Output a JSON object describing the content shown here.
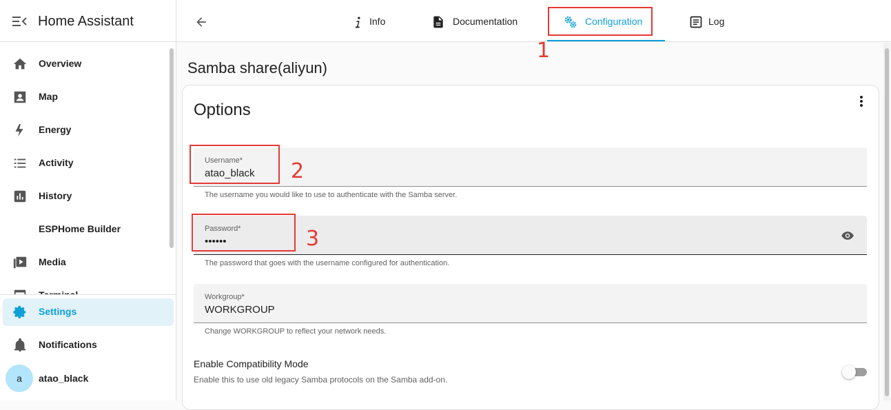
{
  "app": {
    "title": "Home Assistant"
  },
  "sidebar": {
    "items": [
      {
        "label": "Overview",
        "icon": "home-icon"
      },
      {
        "label": "Map",
        "icon": "map-icon"
      },
      {
        "label": "Energy",
        "icon": "lightning-bolt-icon"
      },
      {
        "label": "Activity",
        "icon": "list-icon"
      },
      {
        "label": "History",
        "icon": "chart-box-icon"
      },
      {
        "label": "ESPHome Builder",
        "icon": ""
      },
      {
        "label": "Media",
        "icon": "play-box-icon"
      },
      {
        "label": "Terminal",
        "icon": "console-icon"
      }
    ],
    "settings": {
      "label": "Settings",
      "icon": "gear-icon",
      "active": true
    },
    "notifications": {
      "label": "Notifications",
      "icon": "bell-icon"
    },
    "user": {
      "avatar_letter": "a",
      "name": "atao_black"
    }
  },
  "tabs": [
    {
      "label": "Info",
      "icon": "info-italic-icon",
      "active": false
    },
    {
      "label": "Documentation",
      "icon": "document-icon",
      "active": false
    },
    {
      "label": "Configuration",
      "icon": "cogs-icon",
      "active": true
    },
    {
      "label": "Log",
      "icon": "text-box-icon",
      "active": false
    }
  ],
  "annotations": [
    "1",
    "2",
    "3"
  ],
  "page": {
    "title": "Samba share(aliyun)"
  },
  "options": {
    "title": "Options",
    "fields": [
      {
        "label": "Username*",
        "value": "atao_black",
        "helper": "The username you would like to use to authenticate with the Samba server."
      },
      {
        "label": "Password*",
        "value": "••••••",
        "helper": "The password that goes with the username configured for authentication."
      },
      {
        "label": "Workgroup*",
        "value": "WORKGROUP",
        "helper": "Change WORKGROUP to reflect your network needs."
      }
    ],
    "compat": {
      "title": "Enable Compatibility Mode",
      "description": "Enable this to use old legacy Samba protocols on the Samba add-on.",
      "enabled": false
    }
  },
  "colors": {
    "accent": "#0d9fd8",
    "annotation": "#e53935",
    "active_bg": "#e1f2f8"
  }
}
